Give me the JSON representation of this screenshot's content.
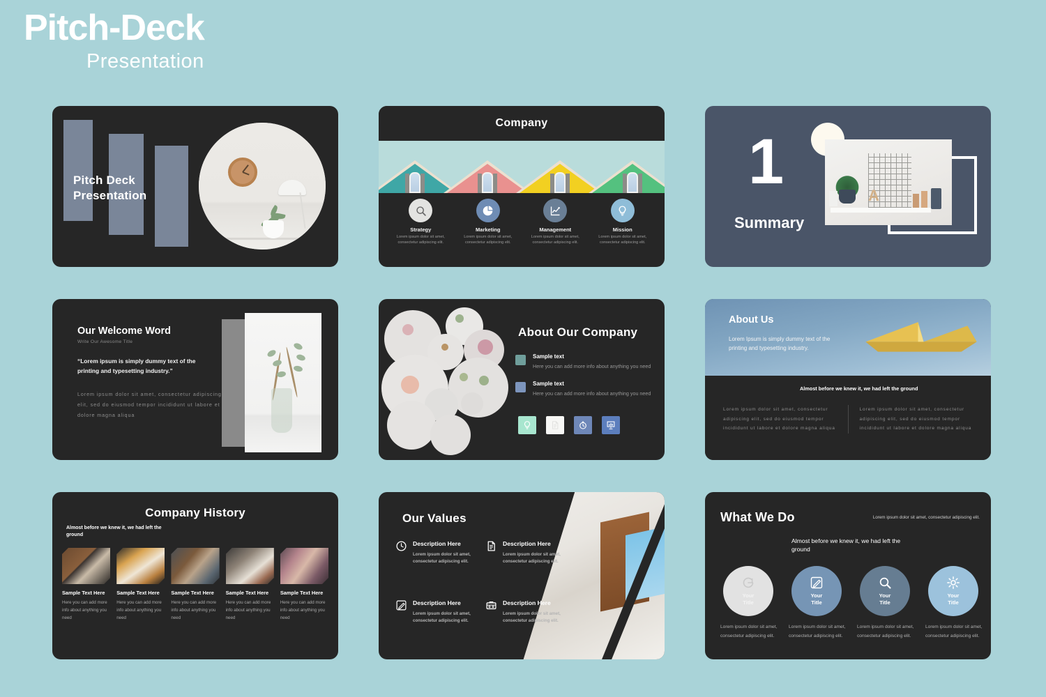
{
  "header": {
    "title": "Pitch-Deck",
    "subtitle": "Presentation"
  },
  "colors": {
    "page_background": "#a9d3d8",
    "slide_dark": "#262626",
    "slate": "#4a5568",
    "bar_gray": "#7a8699",
    "accent_teal": "#6f9e9b",
    "accent_blue": "#7d95bd",
    "mint": "#a8e6cf",
    "roof_teal": "#3fa7a6",
    "roof_pink": "#e9918f",
    "roof_yellow": "#f2d021",
    "roof_green": "#54c17f"
  },
  "slides": {
    "title_slide": {
      "title_line1": "Pitch Deck",
      "title_line2": "Presentation",
      "image_alt": "clock-lamp-plant-photo"
    },
    "company": {
      "title": "Company",
      "items": [
        {
          "icon": "magnifier-icon",
          "label": "Strategy",
          "desc": "Lorem ipsum dolor sit amet, consectetur adipiscing elit.",
          "circle_color": "#e3e3e1"
        },
        {
          "icon": "pie-chart-icon",
          "label": "Marketing",
          "desc": "Lorem ipsum dolor sit amet, consectetur adipiscing elit.",
          "circle_color": "#6e8cb4"
        },
        {
          "icon": "line-chart-icon",
          "label": "Management",
          "desc": "Lorem ipsum dolor sit amet, consectetur adipiscing elit.",
          "circle_color": "#6a7f96"
        },
        {
          "icon": "lightbulb-icon",
          "label": "Mission",
          "desc": "Lorem ipsum dolor sit amet, consectetur adipiscing elit.",
          "circle_color": "#8fbdd8"
        }
      ],
      "roof_colors": [
        "#3fa7a6",
        "#e9918f",
        "#f2d021",
        "#54c17f"
      ]
    },
    "summary": {
      "number": "1",
      "label": "Summary",
      "image_alt": "shelf-plant-grid-photo"
    },
    "welcome": {
      "title": "Our Welcome Word",
      "subtitle": "Write Our Awesome Title",
      "quote": "“Lorem ipsum is simply dummy text of the printing and typesetting industry.”",
      "body": "Lorem ipsum dolor sit amet, consectetur adipiscing elit, sed do eiusmod tempor incididunt ut labore et dolore magna aliqua",
      "image_alt": "eucalyptus-vase-photo"
    },
    "about_company": {
      "title": "About Our Company",
      "bullets": [
        {
          "label": "Sample text",
          "desc": "Here you can add more info about anything you need",
          "swatch": "#6f9e9b"
        },
        {
          "label": "Sample text",
          "desc": "Here you can add more info about anything you need",
          "swatch": "#7d95bd"
        }
      ],
      "icons": [
        {
          "name": "lightbulb-icon",
          "bg": "#a8e6cf"
        },
        {
          "name": "document-icon",
          "bg": "#f7f7f5"
        },
        {
          "name": "stopwatch-icon",
          "bg": "#6e87b8"
        },
        {
          "name": "presentation-icon",
          "bg": "#5c7ebd"
        }
      ],
      "image_alt": "flower-circle-collage"
    },
    "about_us": {
      "title": "About Us",
      "lead": "Lorem Ipsum is simply dummy text of the printing and typesetting industry.",
      "headline": "Almost before we knew it, we had left the ground",
      "columns": [
        "Lorem ipsum dolor sit amet, consectetur adipiscing elit, sed do eiusmod tempor incididunt ut labore et dolore magna aliqua",
        "Lorem ipsum dolor sit amet, consectetur adipiscing elit, sed do eiusmod tempor incididunt ut labore et dolore magna aliqua"
      ],
      "image_alt": "yellow-paper-boat-photo"
    },
    "history": {
      "title": "Company History",
      "subtitle": "Almost before we knew it, we had left the ground",
      "cards": [
        {
          "title": "Sample Text Here",
          "desc": "Here you can add more info about anything you need",
          "image_alt": "desk-coffee-notebook-photo"
        },
        {
          "title": "Sample Text Here",
          "desc": "Here you can add more info about anything you need",
          "image_alt": "documents-calculator-photo"
        },
        {
          "title": "Sample Text Here",
          "desc": "Here you can add more info about anything you need",
          "image_alt": "team-meeting-table-photo"
        },
        {
          "title": "Sample Text Here",
          "desc": "Here you can add more info about anything you need",
          "image_alt": "newspaper-reading-photo"
        },
        {
          "title": "Sample Text Here",
          "desc": "Here you can add more info about anything you need",
          "image_alt": "hands-building-blocks-photo"
        }
      ]
    },
    "values": {
      "title": "Our Values",
      "items": [
        {
          "icon": "clock-icon",
          "title": "Description Here",
          "desc": "Lorem ipsum dolor sit amet, consectetur adipiscing elit."
        },
        {
          "icon": "document-icon",
          "title": "Description Here",
          "desc": "Lorem ipsum dolor sit amet, consectetur adipiscing elit."
        },
        {
          "icon": "pencil-icon",
          "title": "Description Here",
          "desc": "Lorem ipsum dolor sit amet, consectetur adipiscing elit."
        },
        {
          "icon": "briefcase-icon",
          "title": "Description Here",
          "desc": "Lorem ipsum dolor sit amet, consectetur adipiscing elit."
        }
      ],
      "image_alt": "room-window-photo"
    },
    "what_we_do": {
      "title": "What We Do",
      "note": "Lorem ipsum dolor sit amet, consectetur adipiscing elit.",
      "headline": "Almost before we knew it, we had left the ground",
      "cards": [
        {
          "icon": "refresh-icon",
          "title": "Your Title",
          "desc": "Lorem ipsum dolor sit amet, consectetur adipiscing elit.",
          "bg": "#e2e2e2",
          "fg": "#ffffff"
        },
        {
          "icon": "pencil-icon",
          "title": "Your Title",
          "desc": "Lorem ipsum dolor sit amet, consectetur adipiscing elit.",
          "bg": "#7695b5",
          "fg": "#ffffff"
        },
        {
          "icon": "magnifier-icon",
          "title": "Your Title",
          "desc": "Lorem ipsum dolor sit amet, consectetur adipiscing elit.",
          "bg": "#667d92",
          "fg": "#ffffff"
        },
        {
          "icon": "gear-icon",
          "title": "Your Title",
          "desc": "Lorem ipsum dolor sit amet, consectetur adipiscing elit.",
          "bg": "#9cc2dc",
          "fg": "#ffffff"
        }
      ]
    }
  }
}
